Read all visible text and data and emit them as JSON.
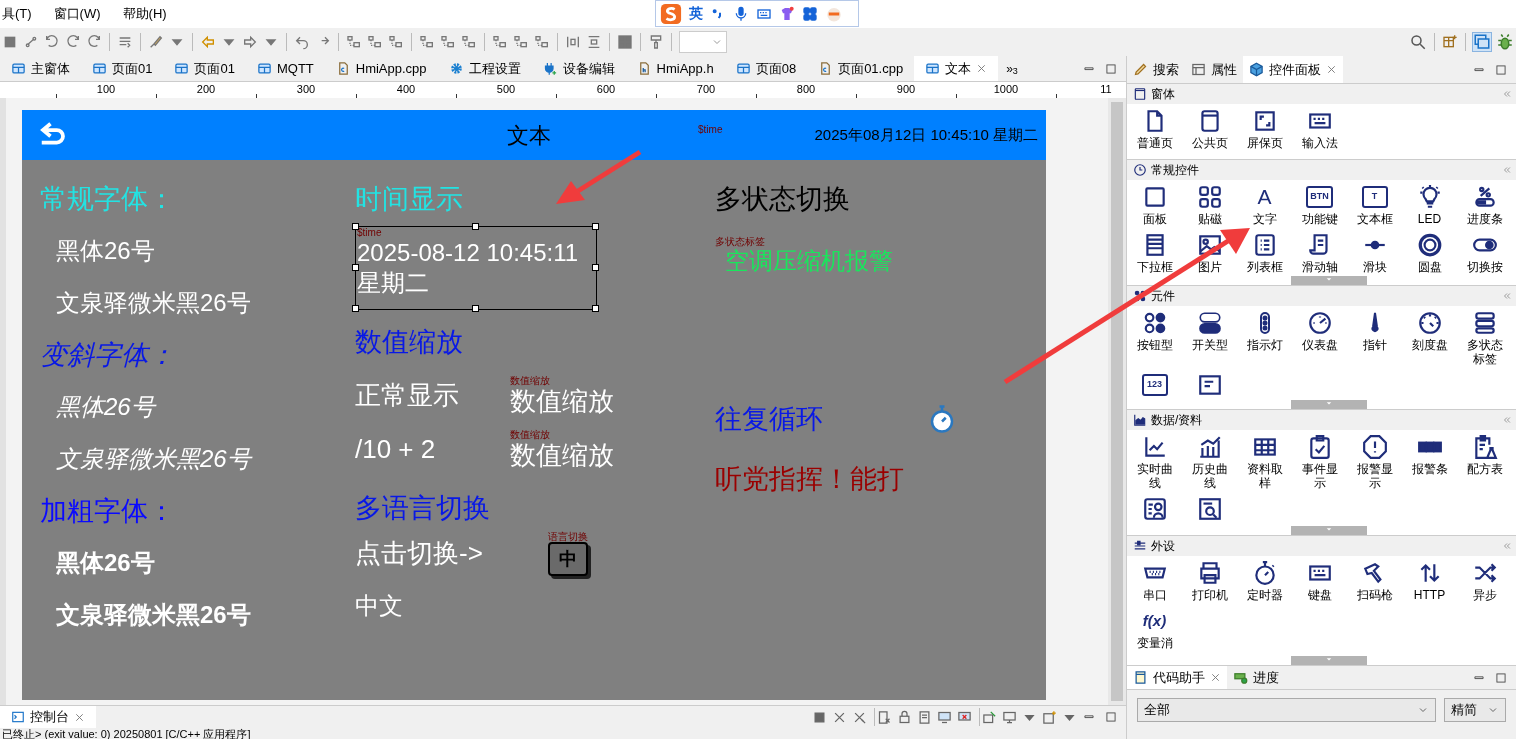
{
  "menu": [
    {
      "label": "具(T)"
    },
    {
      "label": "窗口(W)"
    },
    {
      "label": "帮助(H)"
    }
  ],
  "ime_bar": {
    "mode": "英"
  },
  "editor_tabs": [
    {
      "label": "主窗体",
      "kind": "page",
      "selected": false
    },
    {
      "label": "页面01",
      "kind": "page",
      "selected": false
    },
    {
      "label": "页面01",
      "kind": "page",
      "selected": false
    },
    {
      "label": "MQTT",
      "kind": "page",
      "selected": false
    },
    {
      "label": "HmiApp.cpp",
      "kind": "source",
      "selected": false
    },
    {
      "label": "工程设置",
      "kind": "gear",
      "selected": false
    },
    {
      "label": "设备编辑",
      "kind": "plug",
      "selected": false
    },
    {
      "label": "HmiApp.h",
      "kind": "header",
      "selected": false
    },
    {
      "label": "页面08",
      "kind": "page",
      "selected": false
    },
    {
      "label": "页面01.cpp",
      "kind": "source",
      "selected": false
    },
    {
      "label": "文本",
      "kind": "page",
      "selected": true
    }
  ],
  "editor_tabs_overflow": "»$_{3}$",
  "ruler": [
    "100",
    "200",
    "300",
    "400",
    "500",
    "600",
    "700",
    "800",
    "900",
    "1000",
    "11"
  ],
  "hmi": {
    "title": "文本",
    "time_tag": "$time",
    "datetime": "2025年08月12日 10:45:10 星期二",
    "columns": [
      [
        {
          "kind": "heading",
          "text": "常规字体：",
          "color": "#22e3e3"
        },
        {
          "kind": "text",
          "text": "黑体26号",
          "color": "#ffffff"
        },
        {
          "kind": "text",
          "text": "文泉驿微米黑26号",
          "color": "#ffffff"
        },
        {
          "kind": "heading-italic",
          "text": "变斜字体：",
          "color": "#0818e6"
        },
        {
          "kind": "text-italic",
          "text": "黑体26号",
          "color": "#ffffff"
        },
        {
          "kind": "text-italic",
          "text": "文泉驿微米黑26号",
          "color": "#ffffff"
        },
        {
          "kind": "heading",
          "text": "加粗字体：",
          "color": "#0a0aff"
        },
        {
          "kind": "text-bold",
          "text": "黑体26号",
          "color": "#ffffff"
        },
        {
          "kind": "text-bold",
          "text": "文泉驿微米黑26号",
          "color": "#ffffff"
        }
      ],
      [
        {
          "kind": "heading",
          "text": "时间显示",
          "color": "#22e3e3"
        },
        {
          "kind": "timebox",
          "tag": "$time",
          "lines": [
            "2025-08-12 10:45:11",
            "星期二"
          ],
          "selected": true
        },
        {
          "kind": "heading",
          "text": "数值缩放",
          "color": "#0818e6"
        },
        {
          "kind": "pair",
          "text": "正常显示",
          "tag": "数值缩放",
          "value": "数值缩放"
        },
        {
          "kind": "pair",
          "text": "/10 + 2",
          "tag": "数值缩放",
          "value": "数值缩放"
        },
        {
          "kind": "heading",
          "text": "多语言切换",
          "color": "#0818e6"
        },
        {
          "kind": "language",
          "text": "点击切换->",
          "tag": "语言切换",
          "glyph": "中"
        },
        {
          "kind": "text",
          "text": "中文",
          "color": "#ffffff"
        }
      ],
      [
        {
          "kind": "heading",
          "text": "多状态切换",
          "color": "#000000"
        },
        {
          "kind": "tagged",
          "tag": "多状态标签",
          "text": "空调压缩机报警",
          "color": "#19e65c"
        },
        {
          "kind": "timer_heading",
          "text": "往复循环",
          "color": "#0818e6"
        },
        {
          "kind": "heading",
          "text": "听党指挥！能打",
          "color": "#9a0000"
        }
      ]
    ]
  },
  "panel_tabs": [
    {
      "label": "搜索",
      "kind": "pen",
      "selected": false
    },
    {
      "label": "属性",
      "kind": "table",
      "selected": false
    },
    {
      "label": "控件面板",
      "kind": "cube",
      "selected": true
    }
  ],
  "sections": [
    {
      "title": "窗体",
      "items": [
        {
          "kind": "icon",
          "label": "普通页"
        },
        {
          "kind": "icon",
          "label": "公共页"
        },
        {
          "kind": "icon",
          "label": "屏保页"
        },
        {
          "kind": "icon",
          "label": "输入法"
        }
      ]
    },
    {
      "title": "常规控件",
      "items": [
        {
          "kind": "icon",
          "label": "面板"
        },
        {
          "kind": "icon",
          "label": "贴磁"
        },
        {
          "kind": "glyph",
          "glyph": "A",
          "label": "文字"
        },
        {
          "kind": "boxed",
          "glyph": "BTN",
          "label": "功能键"
        },
        {
          "kind": "boxed",
          "glyph": "T",
          "label": "文本框"
        },
        {
          "kind": "icon",
          "label": "LED"
        },
        {
          "kind": "icon",
          "label": "进度条"
        },
        {
          "kind": "icon",
          "label": "下拉框"
        },
        {
          "kind": "icon",
          "label": "图片"
        },
        {
          "kind": "icon",
          "label": "列表框"
        },
        {
          "kind": "icon",
          "label": "滑动轴"
        },
        {
          "kind": "icon",
          "label": "滑块"
        },
        {
          "kind": "icon",
          "label": "圆盘"
        },
        {
          "kind": "icon",
          "label": "切换按"
        }
      ]
    },
    {
      "title": "元件",
      "items": [
        {
          "kind": "icon",
          "label": "按钮型"
        },
        {
          "kind": "icon",
          "label": "开关型"
        },
        {
          "kind": "icon",
          "label": "指示灯"
        },
        {
          "kind": "icon",
          "label": "仪表盘"
        },
        {
          "kind": "icon",
          "label": "指针"
        },
        {
          "kind": "icon",
          "label": "刻度盘"
        },
        {
          "kind": "icon",
          "label": "多状态标签"
        },
        {
          "kind": "boxed",
          "glyph": "123"
        },
        {
          "kind": "icon"
        }
      ]
    },
    {
      "title": "数据/资料",
      "items": [
        {
          "kind": "icon",
          "label": "实时曲线"
        },
        {
          "kind": "icon",
          "label": "历史曲线"
        },
        {
          "kind": "icon",
          "label": "资料取样"
        },
        {
          "kind": "icon",
          "label": "事件显示"
        },
        {
          "kind": "icon",
          "label": "报警显示"
        },
        {
          "kind": "icon",
          "label": "报警条"
        },
        {
          "kind": "icon",
          "label": "配方表"
        },
        {
          "kind": "icon"
        },
        {
          "kind": "icon"
        }
      ]
    },
    {
      "title": "外设",
      "items": [
        {
          "kind": "icon",
          "label": "串口"
        },
        {
          "kind": "icon",
          "label": "打印机"
        },
        {
          "kind": "icon",
          "label": "定时器"
        },
        {
          "kind": "icon",
          "label": "键盘"
        },
        {
          "kind": "icon",
          "label": "扫码枪"
        },
        {
          "kind": "icon",
          "label": "HTTP"
        },
        {
          "kind": "icon",
          "label": "异步"
        },
        {
          "kind": "glyph",
          "glyph": "f(x)",
          "label": "变量消"
        }
      ]
    }
  ],
  "helper_tabs": [
    {
      "label": "代码助手",
      "selected": true
    },
    {
      "label": "进度",
      "selected": false
    }
  ],
  "helper_filters": [
    "全部",
    "精简"
  ],
  "console": {
    "tab": "控制台",
    "line": "已终止> (exit value: 0) 20250801 [C/C++ 应用程序]"
  }
}
